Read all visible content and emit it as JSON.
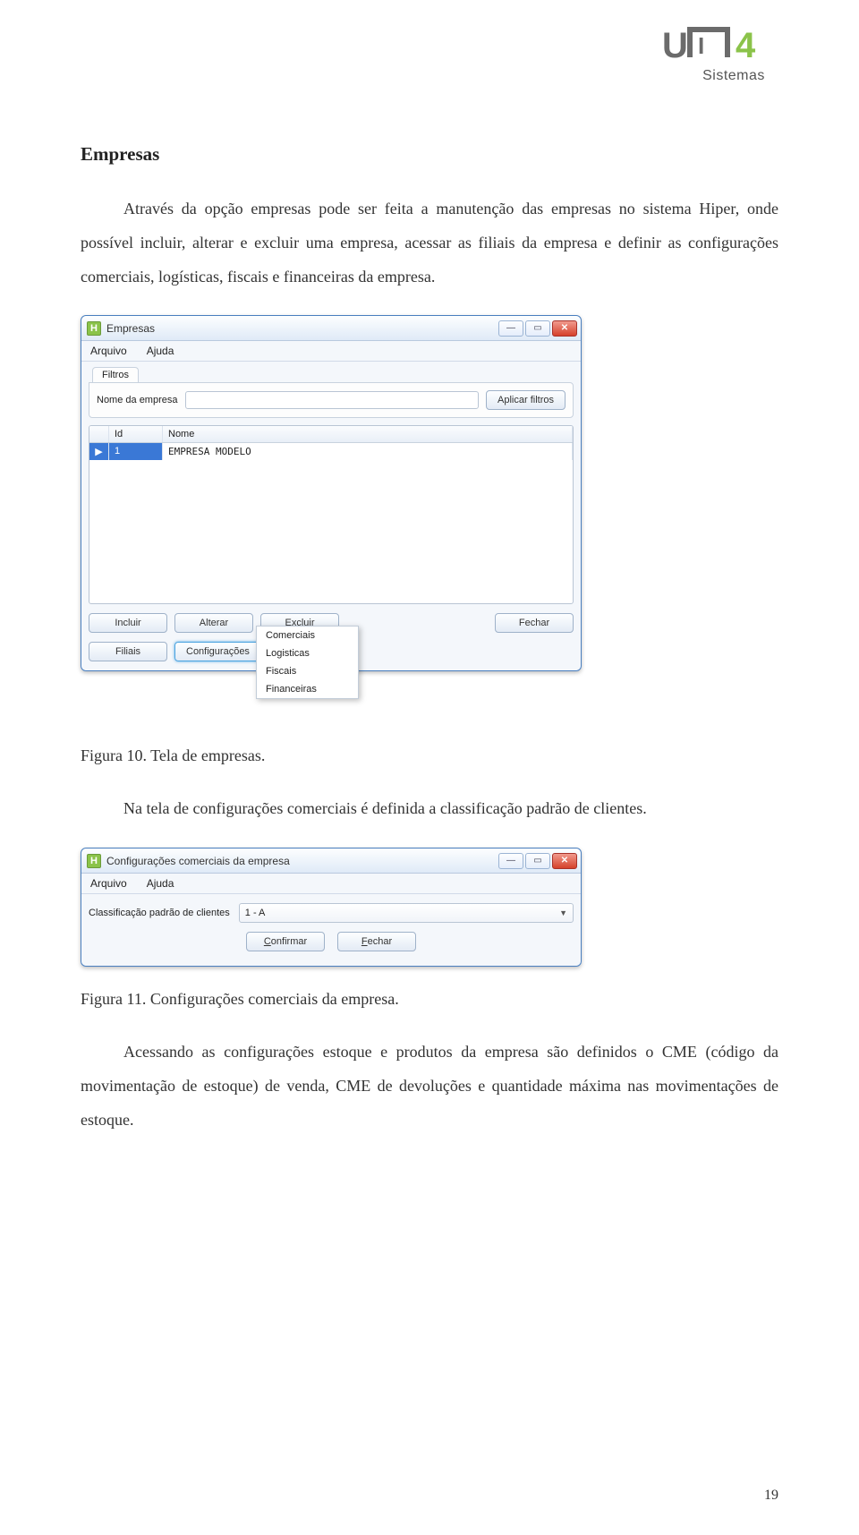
{
  "logo": {
    "brand": "UNI4",
    "sub": "Sistemas"
  },
  "section_title": "Empresas",
  "para1": "Através da opção empresas pode ser feita a manutenção das empresas no sistema Hiper, onde possível incluir, alterar e excluir uma empresa, acessar as filiais da empresa e definir as configurações comerciais, logísticas, fiscais e financeiras da empresa.",
  "caption1": "Figura 10. Tela de empresas.",
  "para2": "Na tela de configurações comerciais é definida a classificação padrão de clientes.",
  "caption2": "Figura 11. Configurações comerciais da empresa.",
  "para3": "Acessando as configurações estoque e produtos da empresa são definidos o CME (código da movimentação de estoque) de venda, CME de devoluções e quantidade máxima nas movimentações de estoque.",
  "page_number": "19",
  "win1": {
    "title": "Empresas",
    "menu": {
      "arquivo": "Arquivo",
      "ajuda": "Ajuda"
    },
    "tab_filtros": "Filtros",
    "lbl_nome": "Nome da empresa",
    "btn_aplicar": "Aplicar filtros",
    "cols": {
      "id": "Id",
      "nome": "Nome"
    },
    "row": {
      "marker": "▶",
      "id": "1",
      "nome": "EMPRESA MODELO"
    },
    "btns": {
      "incluir": "Incluir",
      "alterar": "Alterar",
      "excluir": "Excluir",
      "fechar": "Fechar",
      "filiais": "Filiais",
      "config": "Configurações"
    },
    "popup": {
      "comerciais": "Comerciais",
      "logisticas": "Logisticas",
      "fiscais": "Fiscais",
      "financeiras": "Financeiras"
    }
  },
  "win2": {
    "title": "Configurações comerciais da empresa",
    "menu": {
      "arquivo": "Arquivo",
      "ajuda": "Ajuda"
    },
    "lbl_class": "Classificação padrão de clientes",
    "combo_value": "1 - A",
    "btn_confirmar_u": "C",
    "btn_confirmar_rest": "onfirmar",
    "btn_fechar_u": "F",
    "btn_fechar_rest": "echar"
  }
}
